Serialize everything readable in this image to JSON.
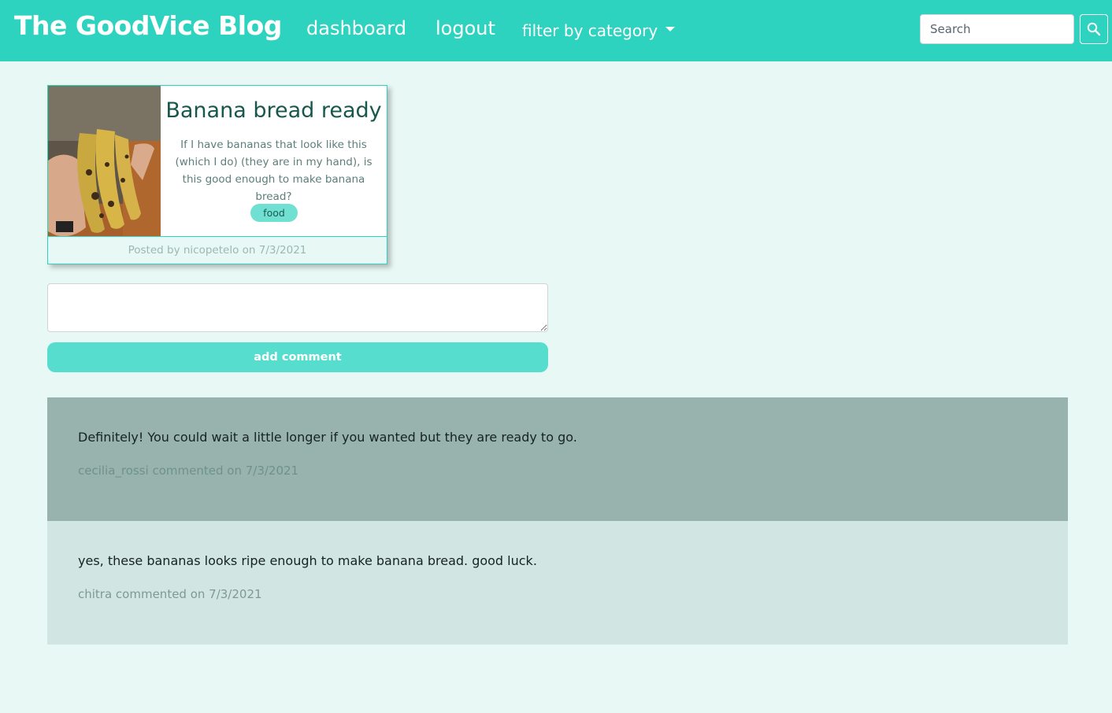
{
  "navbar": {
    "brand": "The GoodVice Blog",
    "links": {
      "dashboard": "dashboard",
      "logout": "logout",
      "filter": "filter by category"
    },
    "search": {
      "placeholder": "Search",
      "value": ""
    },
    "search_icon": "search-icon"
  },
  "post": {
    "image": "bananas-photo",
    "title": "Banana bread ready",
    "body": "If I have bananas that look like this (which I do) (they are in my hand), is this good enough to make banana bread?",
    "category": "food",
    "footer": "Posted by nicopetelo on 7/3/2021"
  },
  "comment_form": {
    "textarea_value": "",
    "submit_label": "add comment"
  },
  "comments": [
    {
      "text": "Definitely! You could wait a little longer if you wanted but they are ready to go.",
      "meta": "cecilia_rossi commented on 7/3/2021"
    },
    {
      "text": "yes, these bananas looks ripe enough to make banana bread. good luck.",
      "meta": "chitra commented on 7/3/2021"
    }
  ],
  "colors": {
    "navbar": "#2ed3bf",
    "page_background": "#e8f8f5",
    "title": "#17574c",
    "badge": "#6fe0d1",
    "button": "#57ddcd",
    "comment_dark": "#98b3ae",
    "comment_light": "#d1e5e2"
  }
}
